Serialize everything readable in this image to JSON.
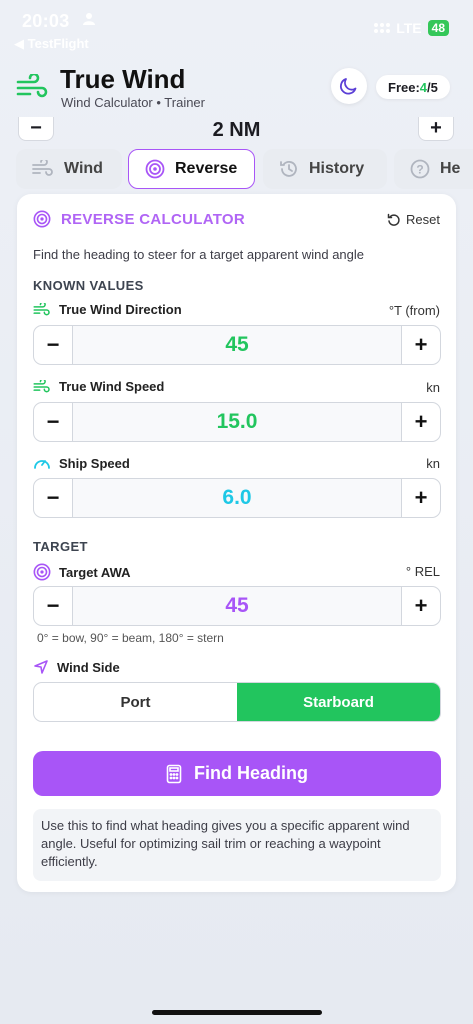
{
  "status_bar": {
    "time": "20:03",
    "back_app": "◀ TestFlight",
    "network": "LTE",
    "battery": "48"
  },
  "header": {
    "title": "True Wind",
    "subtitle": "Wind Calculator • Trainer",
    "free_label": "Free: ",
    "free_used": "4",
    "free_total": "/5"
  },
  "distance_row": {
    "value": "2 NM",
    "minus": "−",
    "plus": "+"
  },
  "tabs": [
    {
      "label": "Wind",
      "icon": "wind-icon",
      "active": false
    },
    {
      "label": "Reverse",
      "icon": "target-icon",
      "active": true
    },
    {
      "label": "History",
      "icon": "history-icon",
      "active": false
    },
    {
      "label": "He",
      "icon": "help-icon",
      "active": false
    }
  ],
  "card": {
    "title": "REVERSE CALCULATOR",
    "reset_label": "Reset",
    "description": "Find the heading to steer for a target apparent wind angle",
    "known_section": "KNOWN VALUES",
    "fields": {
      "twd": {
        "label": "True Wind Direction",
        "unit": "°T (from)",
        "value": "45",
        "color": "#22c55e"
      },
      "tws": {
        "label": "True Wind Speed",
        "unit": "kn",
        "value": "15.0",
        "color": "#22c55e"
      },
      "ship": {
        "label": "Ship Speed",
        "unit": "kn",
        "value": "6.0",
        "color": "#1ec8e6"
      }
    },
    "target_section": "TARGET",
    "target": {
      "label": "Target AWA",
      "unit": "° REL",
      "value": "45",
      "color": "#a855f7",
      "hint": "0° = bow, 90° = beam, 180° = stern"
    },
    "wind_side": {
      "label": "Wind Side",
      "options": [
        "Port",
        "Starboard"
      ],
      "selected": "Starboard"
    },
    "find_button": "Find Heading",
    "info": "Use this to find what heading gives you a specific apparent wind angle. Useful for optimizing sail trim or reaching a waypoint efficiently.",
    "stepper_minus": "−",
    "stepper_plus": "+"
  },
  "colors": {
    "accent": "#a855f7",
    "green": "#22c55e",
    "cyan": "#1ec8e6"
  }
}
